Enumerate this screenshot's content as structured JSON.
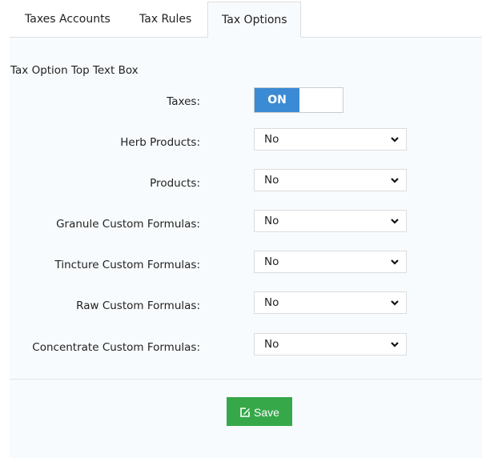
{
  "tabs": [
    {
      "label": "Taxes Accounts",
      "active": false
    },
    {
      "label": "Tax Rules",
      "active": false
    },
    {
      "label": "Tax Options",
      "active": true
    }
  ],
  "form": {
    "top_text": "Tax Option Top Text Box",
    "taxes": {
      "label": "Taxes:",
      "toggle_state": "ON",
      "toggle_color": "#3b8ad4"
    },
    "fields": [
      {
        "label": "Herb Products:",
        "value": "No"
      },
      {
        "label": "Products:",
        "value": "No"
      },
      {
        "label": "Granule Custom Formulas:",
        "value": "No"
      },
      {
        "label": "Tincture Custom Formulas:",
        "value": "No"
      },
      {
        "label": "Raw Custom Formulas:",
        "value": "No"
      },
      {
        "label": "Concentrate Custom Formulas:",
        "value": "No"
      }
    ]
  },
  "actions": {
    "save_label": "Save",
    "save_icon": "edit-icon",
    "save_color": "#36a84a"
  }
}
